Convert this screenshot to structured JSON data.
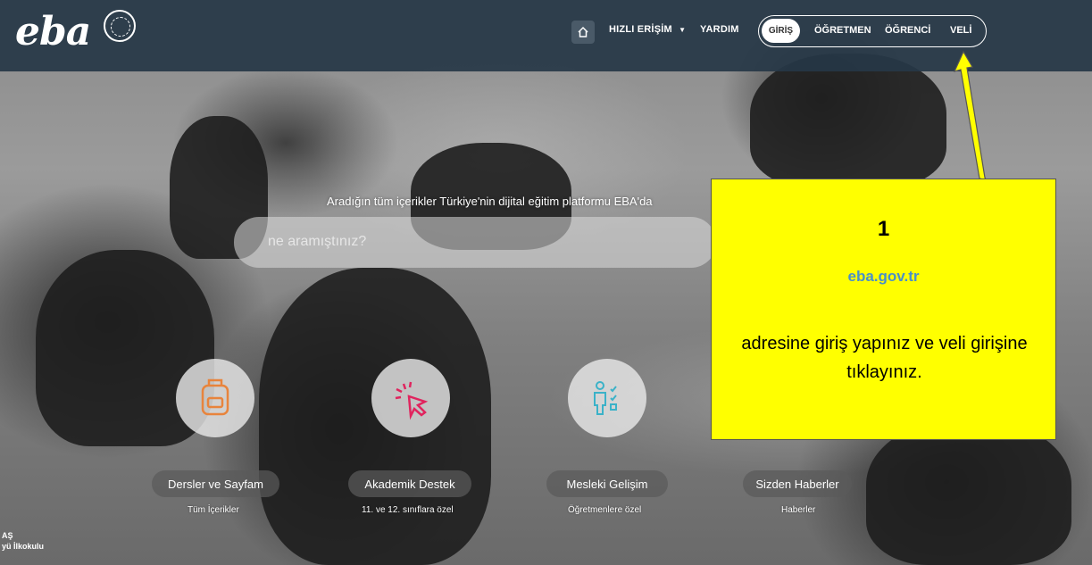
{
  "navbar": {
    "logo_text": "eba",
    "quick_access_label": "HIZLI ERİŞİM",
    "help_label": "YARDIM",
    "login_label": "GİRİŞ",
    "teacher_label": "ÖĞRETMEN",
    "student_label": "ÖĞRENCİ",
    "parent_label": "VELİ"
  },
  "hero": {
    "tagline": "Aradığın tüm içerikler Türkiye'nin dijital eğitim platformu EBA'da",
    "search_placeholder": "ne aramıştınız?"
  },
  "features": [
    {
      "title": "Dersler ve Sayfam",
      "subtitle": "Tüm İçerikler",
      "icon": "backpack-icon",
      "color": "#e8843c"
    },
    {
      "title": "Akademik Destek",
      "subtitle": "11. ve 12. sınıflara özel",
      "icon": "cursor-click-icon",
      "color": "#e0245e"
    },
    {
      "title": "Mesleki Gelişim",
      "subtitle": "Öğretmenlere özel",
      "icon": "checklist-person-icon",
      "color": "#3bb2c8"
    },
    {
      "title": "Sizden Haberler",
      "subtitle": "Haberler",
      "icon": "news-icon",
      "color": "#888888"
    }
  ],
  "callout": {
    "step_number": "1",
    "url": "eba.gov.tr",
    "instruction": "adresine giriş yapınız ve veli girişine tıklayınız.",
    "background": "#ffff00",
    "url_color": "#4a90c8"
  },
  "photo_credit": {
    "line1": "AŞ",
    "line2": "yü İlkokulu"
  },
  "colors": {
    "navbar": "#263746",
    "arrow": "#ffff00"
  }
}
